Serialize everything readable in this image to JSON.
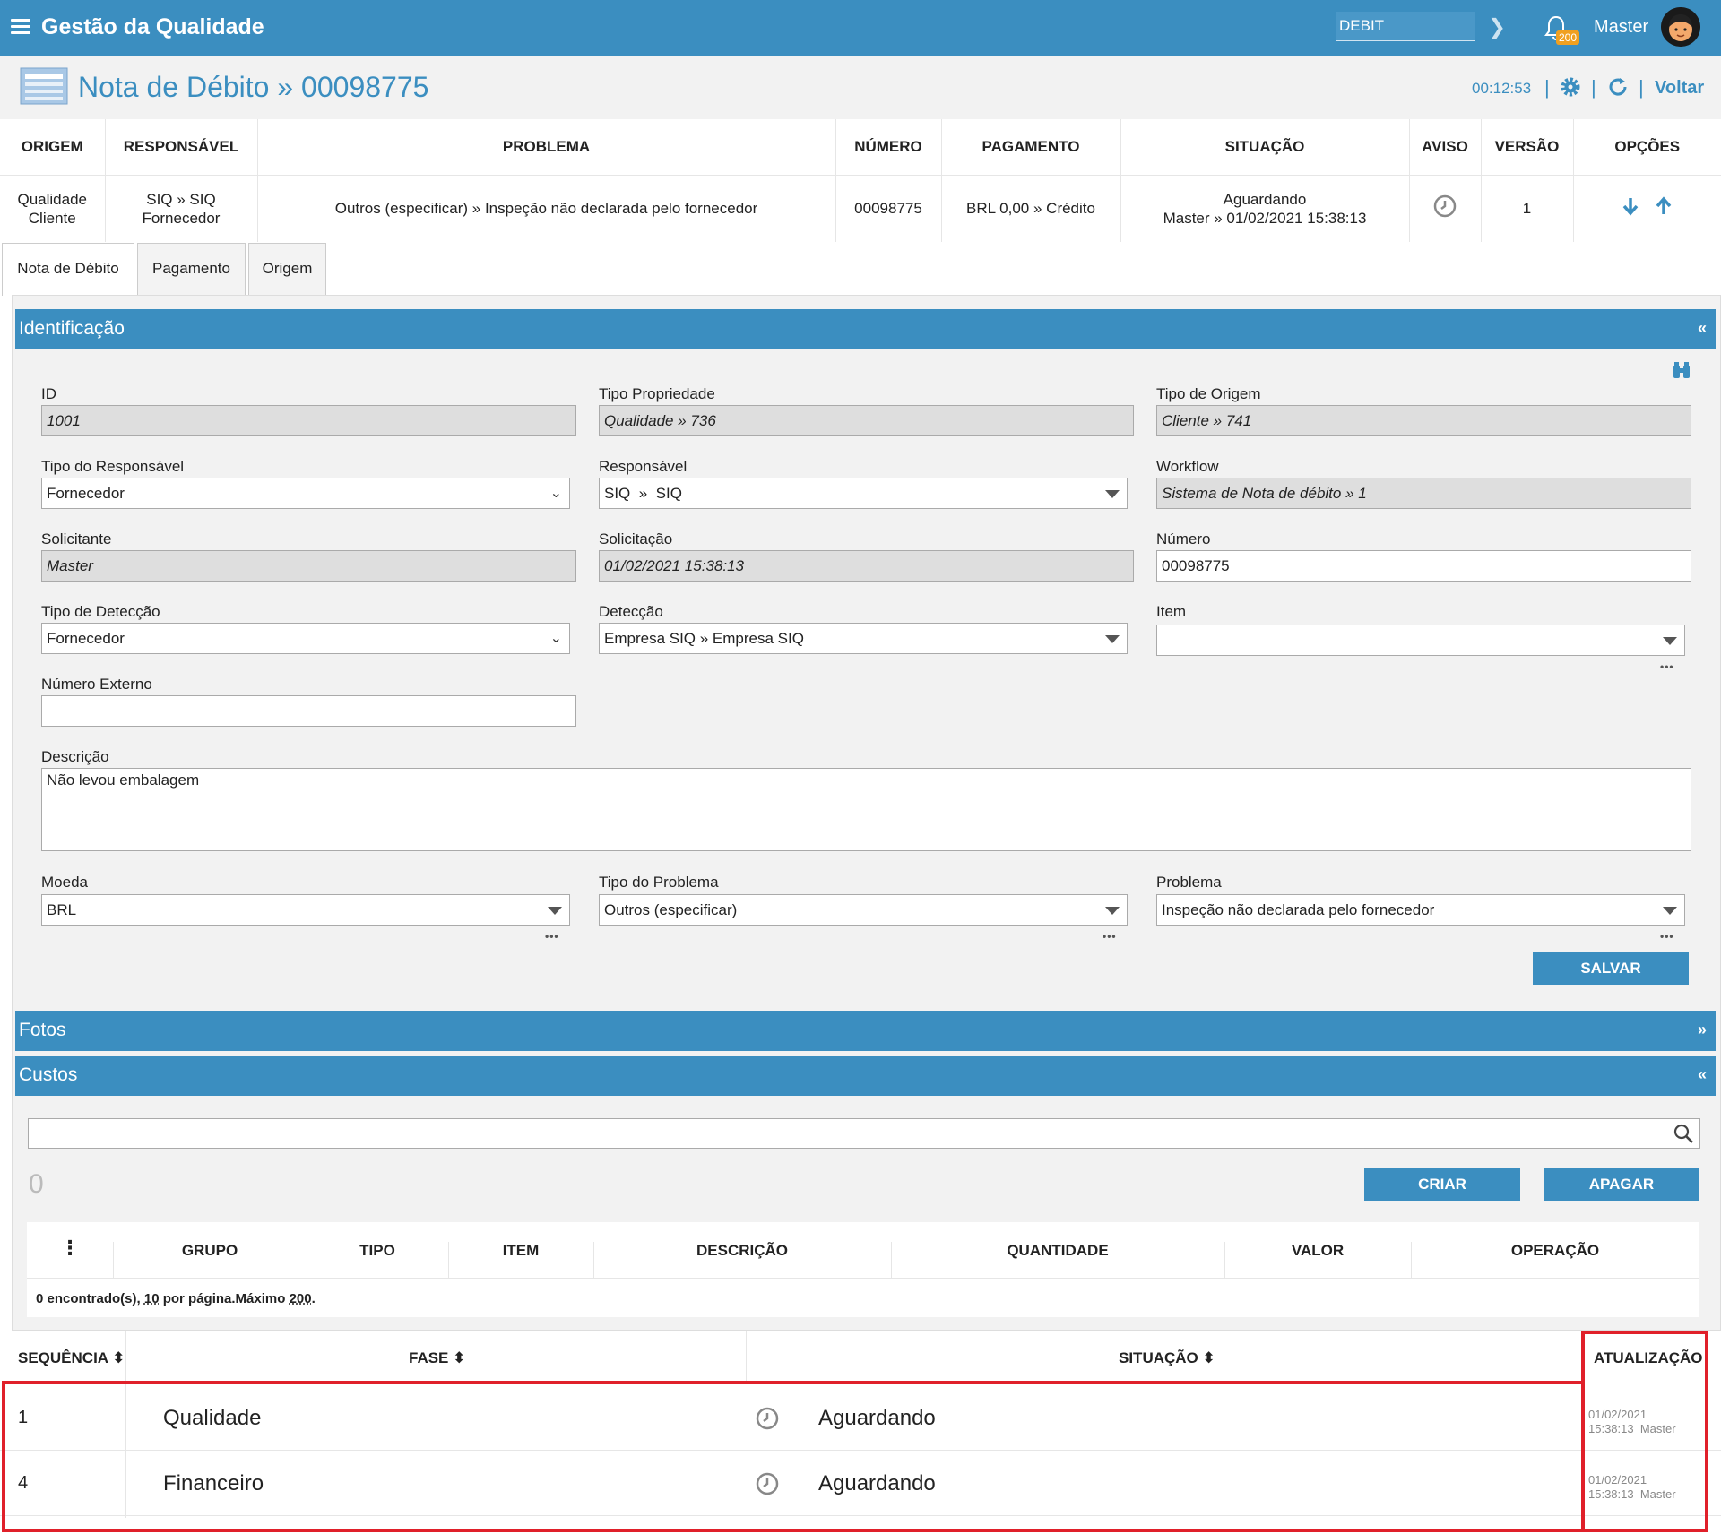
{
  "topbar": {
    "title": "Gestão da Qualidade",
    "search_value": "DEBIT",
    "notification_count": "200",
    "user": "Master"
  },
  "header": {
    "title": "Nota de Débito » 00098775",
    "timer": "00:12:53",
    "back": "Voltar"
  },
  "summary": {
    "headers": [
      "ORIGEM",
      "RESPONSÁVEL",
      "PROBLEMA",
      "NÚMERO",
      "PAGAMENTO",
      "SITUAÇÃO",
      "AVISO",
      "VERSÃO",
      "OPÇÕES"
    ],
    "origem": [
      "Qualidade",
      "Cliente"
    ],
    "responsavel": [
      "SIQ » SIQ",
      "Fornecedor"
    ],
    "problema": "Outros (especificar) » Inspeção não declarada pelo fornecedor",
    "numero": "00098775",
    "pagamento": "BRL 0,00 » Crédito",
    "situacao": [
      "Aguardando",
      "Master » 01/02/2021 15:38:13"
    ],
    "versao": "1"
  },
  "tabs": [
    "Nota de Débito",
    "Pagamento",
    "Origem"
  ],
  "identificacao": {
    "title": "Identificação",
    "collapse": "«",
    "labels": {
      "id": "ID",
      "tipo_propriedade": "Tipo Propriedade",
      "tipo_origem": "Tipo de Origem",
      "tipo_responsavel": "Tipo do Responsável",
      "responsavel": "Responsável",
      "workflow": "Workflow",
      "solicitante": "Solicitante",
      "solicitacao": "Solicitação",
      "numero": "Número",
      "tipo_deteccao": "Tipo de Detecção",
      "deteccao": "Detecção",
      "item": "Item",
      "numero_externo": "Número Externo",
      "descricao": "Descrição",
      "moeda": "Moeda",
      "tipo_problema": "Tipo do Problema",
      "problema": "Problema"
    },
    "values": {
      "id": "1001",
      "tipo_propriedade": "Qualidade » 736",
      "tipo_origem": "Cliente » 741",
      "tipo_responsavel": "Fornecedor",
      "responsavel": "SIQ  »  SIQ",
      "workflow": "Sistema de Nota de débito » 1",
      "solicitante": "Master",
      "solicitacao": "01/02/2021 15:38:13",
      "numero": "00098775",
      "tipo_deteccao": "Fornecedor",
      "deteccao": "Empresa SIQ » Empresa SIQ",
      "item": "",
      "numero_externo": "",
      "descricao": "Não levou embalagem",
      "moeda": "BRL",
      "tipo_problema": "Outros (especificar)",
      "problema": "Inspeção não declarada pelo fornecedor"
    },
    "ellipsis": "•••",
    "save": "SALVAR"
  },
  "fotos": {
    "title": "Fotos",
    "collapse": "»"
  },
  "custos": {
    "title": "Custos",
    "collapse": "«",
    "search_value": "",
    "count": "0",
    "create": "CRIAR",
    "delete": "APAGAR",
    "menu": "⋮",
    "columns": [
      "GRUPO",
      "TIPO",
      "ITEM",
      "DESCRIÇÃO",
      "QUANTIDADE",
      "VALOR",
      "OPERAÇÃO"
    ],
    "footer": {
      "found": "0 encontrado(s),",
      "per_page": "10",
      "per_page_text": "por página.Máximo",
      "max": "200",
      "end": "."
    }
  },
  "workflow": {
    "columns": [
      "SEQUÊNCIA ⬍",
      "FASE ⬍",
      "SITUAÇÃO ⬍",
      "ATUALIZAÇÃO"
    ],
    "rows": [
      {
        "seq": "1",
        "fase": "Qualidade",
        "situacao": "Aguardando",
        "date": "01/02/2021",
        "time_user": "15:38:13  Master"
      },
      {
        "seq": "4",
        "fase": "Financeiro",
        "situacao": "Aguardando",
        "date": "01/02/2021",
        "time_user": "15:38:13  Master"
      }
    ]
  },
  "colors": {
    "primary": "#3b8ec0",
    "highlight": "#e0202a",
    "badge": "#f0a020"
  }
}
